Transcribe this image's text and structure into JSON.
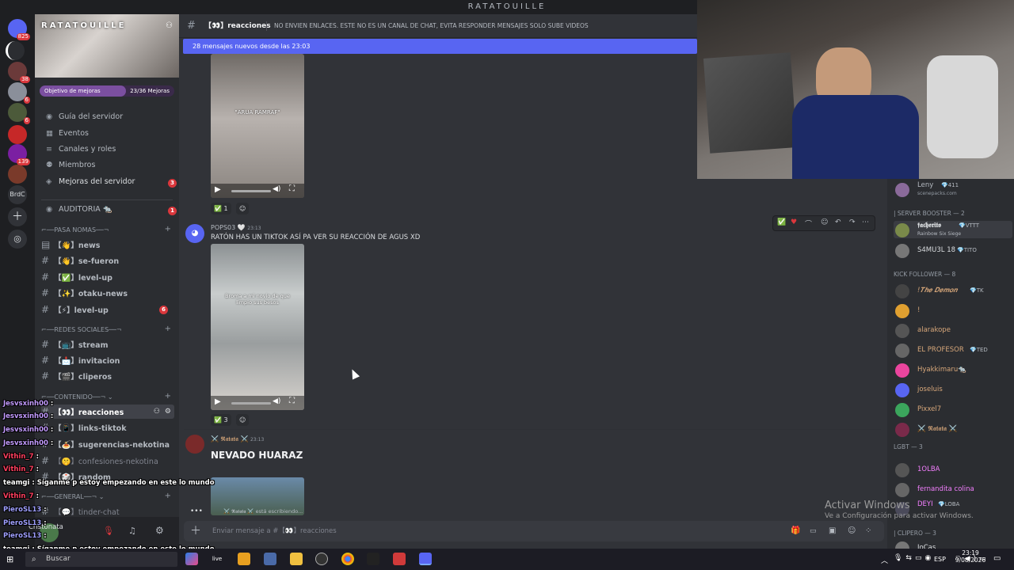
{
  "window_title": "RATATOUILLE",
  "server": {
    "name": "RATATOUILLE",
    "boost_goal_label": "Objetivo de mejoras",
    "boost_progress": "23/36 Mejoras",
    "boost_fraction": 0.64
  },
  "rail_badges": [
    "825",
    "38",
    "6",
    "6",
    "139"
  ],
  "rail_label": "BrdC",
  "nav_items": [
    {
      "label": "Guía del servidor",
      "icon": "compass-icon"
    },
    {
      "label": "Eventos",
      "icon": "calendar-icon"
    },
    {
      "label": "Canales y roles",
      "icon": "list-icon"
    },
    {
      "label": "Miembros",
      "icon": "members-icon"
    },
    {
      "label": "Mejoras del servidor",
      "icon": "boost-icon",
      "badge": "3"
    }
  ],
  "audit": {
    "label": "AUDITORIA 🐀",
    "badge": "1"
  },
  "categories": [
    {
      "label": "PASA NOMAS",
      "channels": [
        {
          "label": "【👋】news"
        },
        {
          "label": "【👋】se-fueron"
        },
        {
          "label": "【✅】level-up"
        },
        {
          "label": "【✨】otaku-news"
        },
        {
          "label": "【⚡】level-up",
          "badge": "6"
        }
      ]
    },
    {
      "label": "REDES SOCIALES",
      "channels": [
        {
          "label": "【📺】stream"
        },
        {
          "label": "【📩】invitacion"
        },
        {
          "label": "【🎬】cliperos"
        }
      ]
    },
    {
      "label": "CONTENIDO",
      "channels": [
        {
          "label": "【👀】reacciones",
          "active": true
        },
        {
          "label": "【📱】links-tiktok"
        },
        {
          "label": "【🍝】sugerencias-nekotina"
        },
        {
          "label": "【🤫】confesiones-nekotina"
        },
        {
          "label": "【🎲】random"
        }
      ]
    },
    {
      "label": "GENERAL",
      "channels": [
        {
          "label": "【💬】tinder-chat"
        }
      ]
    }
  ],
  "user_panel": {
    "username": "Cristonata"
  },
  "channel_header": {
    "name": "【👀】reacciones",
    "topic": "NO ENVIEN ENLACES. ESTE NO ES UN CANAL DE CHAT, EVITA RESPONDER MENSAJES SOLO SUBE VIDEOS"
  },
  "new_messages_bar": "28 mensajes nuevos desde las 23:03",
  "messages": [
    {
      "video_caption": "\"ARUA RAMRAF\"",
      "reaction_count": "1"
    },
    {
      "author": "POPS03 🤍",
      "time": "23:13",
      "text": "RATÓN HAS UN TIKTOK ASÍ PA VER SU REACCIÓN DE AGUS XD",
      "video_caption": "Broma a mi novio de que limpio sus besos",
      "reaction_count": "3"
    },
    {
      "author": "⚔️ 𝕽𝖆𝖙𝖆𝖙𝖆 ⚔️",
      "time": "23:13",
      "text": "NEVADO HUARAZ",
      "typing": "⚔️ 𝕽𝖆𝖙𝖆𝖙𝖆 ⚔️ está escribiendo..."
    }
  ],
  "composer_placeholder": "Enviar mensaje a #【👀】reacciones",
  "members": {
    "top": {
      "name": "Leny",
      "tag": "💎411",
      "status": "scenepacks.com"
    },
    "sections": [
      {
        "label": "| SERVER BOOSTER — 2",
        "items": [
          {
            "name": "𝖋𝖆𝖈𝖍𝖊𝖗𝖎𝖙𝖔",
            "tag": "💎VTTT",
            "status": "Rainbow Six Siege",
            "color": "#ffffff"
          },
          {
            "name": "S4MU3L 18",
            "tag": "💎TITO",
            "color": "#dbdee1"
          }
        ]
      },
      {
        "label": "KICK FOLLOWER — 8",
        "items": [
          {
            "name": "!𝑻𝒉𝒆 𝑫𝒆𝒎𝒐𝒏",
            "tag": "💎TK",
            "color": "#d7a77a"
          },
          {
            "name": "!",
            "color": "#d7a77a"
          },
          {
            "name": "alarakope",
            "color": "#d7a77a"
          },
          {
            "name": "EL PROFESOR",
            "tag": "💎TED",
            "color": "#d7a77a"
          },
          {
            "name": "Hyakkimaru🐀",
            "color": "#d7a77a"
          },
          {
            "name": "joseluis",
            "color": "#d7a77a"
          },
          {
            "name": "Pixxel7",
            "color": "#d7a77a"
          },
          {
            "name": "⚔️ 𝕽𝖆𝖙𝖆𝖙𝖆 ⚔️",
            "color": "#d7a77a"
          }
        ]
      },
      {
        "label": "LGBT — 3",
        "items": [
          {
            "name": "1OLBA",
            "color": "#f47fff"
          },
          {
            "name": "fernandita colina",
            "color": "#f47fff"
          },
          {
            "name": "DEYI",
            "tag": "💎LOBA",
            "color": "#f47fff"
          }
        ]
      },
      {
        "label": "| CLIPERO — 3",
        "items": [
          {
            "name": "JoCas",
            "color": "#dbdee1"
          }
        ]
      }
    ]
  },
  "stream_chat": [
    {
      "user": "Jesvsxinh00",
      "text": ":",
      "color": "#c39bff"
    },
    {
      "user": "Jesvsxinh00",
      "text": ":",
      "color": "#c39bff"
    },
    {
      "user": "Jesvsxinh00",
      "text": ":",
      "color": "#c39bff"
    },
    {
      "user": "Jesvsxinh00",
      "text": ":",
      "color": "#c39bff"
    },
    {
      "user": "Vithin_7",
      "text": ":",
      "color": "#ff3f5f"
    },
    {
      "user": "Vithin_7",
      "text": ":",
      "color": "#ff3f5f"
    },
    {
      "user": "teamgi",
      "text": ": Síganme p estoy empezando en este lo mundo",
      "color": "#ffffff"
    },
    {
      "user": "Vithin_7",
      "text": ":",
      "color": "#ff3f5f"
    },
    {
      "user": "PieroSL13",
      "text": ":",
      "color": "#9f9fff"
    },
    {
      "user": "PieroSL13",
      "text": ":",
      "color": "#9f9fff"
    },
    {
      "user": "PieroSL13",
      "text": ":",
      "color": "#9f9fff"
    },
    {
      "user": "teamgi",
      "text": ": Síganme p estoy empezando en este lo mundo",
      "color": "#ffffff"
    }
  ],
  "windows_watermark": {
    "title": "Activar Windows",
    "subtitle": "Ve a Configuración para activar Windows."
  },
  "taskbar": {
    "search_placeholder": "Buscar",
    "language": "ESP",
    "time": "23:19",
    "date": "9/08/2026"
  }
}
